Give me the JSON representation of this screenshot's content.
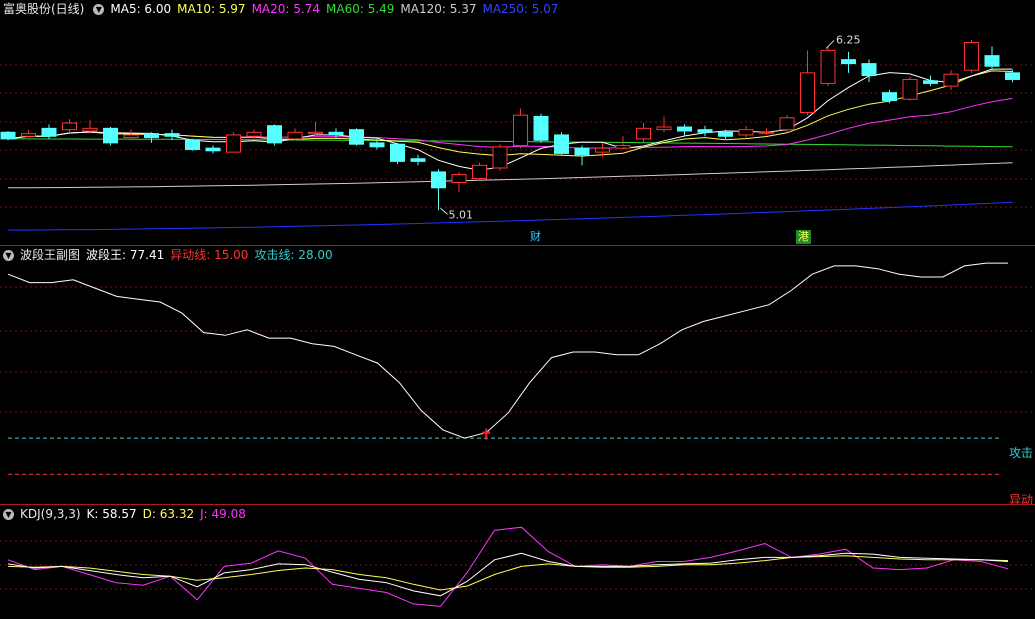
{
  "main": {
    "title": "富奥股份(日线)",
    "ma": [
      {
        "label": "MA5: 6.00",
        "color": "#ffffff"
      },
      {
        "label": "MA10: 5.97",
        "color": "#ffff55"
      },
      {
        "label": "MA20: 5.74",
        "color": "#ff33ff"
      },
      {
        "label": "MA60: 5.49",
        "color": "#33dd33"
      },
      {
        "label": "MA120: 5.37",
        "color": "#cccccc"
      },
      {
        "label": "MA250: 5.07",
        "color": "#3344ff"
      }
    ],
    "high_label": "6.25",
    "low_label": "5.01",
    "markers": {
      "cai": "财",
      "gang": "港"
    },
    "ymin": 4.8,
    "ymax": 6.45,
    "candles": [
      [
        5.6,
        5.55,
        5.61,
        5.54
      ],
      [
        5.57,
        5.59,
        5.62,
        5.56
      ],
      [
        5.63,
        5.57,
        5.66,
        5.55
      ],
      [
        5.62,
        5.67,
        5.7,
        5.6
      ],
      [
        5.61,
        5.63,
        5.69,
        5.59
      ],
      [
        5.63,
        5.52,
        5.64,
        5.5
      ],
      [
        5.56,
        5.58,
        5.62,
        5.55
      ],
      [
        5.59,
        5.56,
        5.6,
        5.52
      ],
      [
        5.59,
        5.57,
        5.62,
        5.54
      ],
      [
        5.54,
        5.47,
        5.55,
        5.46
      ],
      [
        5.48,
        5.46,
        5.5,
        5.44
      ],
      [
        5.45,
        5.58,
        5.6,
        5.45
      ],
      [
        5.57,
        5.6,
        5.62,
        5.55
      ],
      [
        5.65,
        5.52,
        5.66,
        5.5
      ],
      [
        5.55,
        5.6,
        5.63,
        5.54
      ],
      [
        5.59,
        5.6,
        5.68,
        5.57
      ],
      [
        5.6,
        5.58,
        5.63,
        5.56
      ],
      [
        5.62,
        5.51,
        5.63,
        5.5
      ],
      [
        5.52,
        5.49,
        5.55,
        5.47
      ],
      [
        5.51,
        5.38,
        5.52,
        5.36
      ],
      [
        5.4,
        5.38,
        5.43,
        5.35
      ],
      [
        5.3,
        5.18,
        5.32,
        5.01
      ],
      [
        5.22,
        5.28,
        5.3,
        5.15
      ],
      [
        5.25,
        5.35,
        5.37,
        5.23
      ],
      [
        5.33,
        5.49,
        5.51,
        5.31
      ],
      [
        5.5,
        5.73,
        5.78,
        5.48
      ],
      [
        5.72,
        5.54,
        5.74,
        5.52
      ],
      [
        5.58,
        5.44,
        5.6,
        5.43
      ],
      [
        5.48,
        5.43,
        5.5,
        5.35
      ],
      [
        5.45,
        5.48,
        5.52,
        5.41
      ],
      [
        5.48,
        5.5,
        5.57,
        5.47
      ],
      [
        5.55,
        5.63,
        5.67,
        5.52
      ],
      [
        5.62,
        5.64,
        5.72,
        5.6
      ],
      [
        5.64,
        5.61,
        5.66,
        5.57
      ],
      [
        5.62,
        5.6,
        5.65,
        5.57
      ],
      [
        5.6,
        5.57,
        5.62,
        5.55
      ],
      [
        5.58,
        5.62,
        5.65,
        5.56
      ],
      [
        5.6,
        5.6,
        5.63,
        5.58
      ],
      [
        5.62,
        5.71,
        5.73,
        5.6
      ],
      [
        5.75,
        6.05,
        6.22,
        5.73
      ],
      [
        5.97,
        6.22,
        6.25,
        5.95
      ],
      [
        6.15,
        6.12,
        6.21,
        6.05
      ],
      [
        6.12,
        6.03,
        6.15,
        5.98
      ],
      [
        5.9,
        5.84,
        5.92,
        5.82
      ],
      [
        5.85,
        6.0,
        6.02,
        5.84
      ],
      [
        5.99,
        5.97,
        6.03,
        5.95
      ],
      [
        5.95,
        6.04,
        6.07,
        5.92
      ],
      [
        6.07,
        6.28,
        6.3,
        6.05
      ],
      [
        6.18,
        6.1,
        6.25,
        6.08
      ],
      [
        6.05,
        6.0,
        6.07,
        5.98
      ]
    ]
  },
  "sub1": {
    "title": "波段王副图",
    "items": [
      {
        "label": "波段王: 77.41",
        "color": "#ffffff"
      },
      {
        "label": "异动线: 15.00",
        "color": "#ff3333"
      },
      {
        "label": "攻击线: 28.00",
        "color": "#33cccc"
      }
    ],
    "attack_label": "攻击",
    "anomaly_label": "异动",
    "ymin": 5,
    "ymax": 95,
    "attack": 28,
    "anomaly": 15,
    "values": [
      87,
      84,
      84,
      85,
      82,
      79,
      78,
      77,
      73,
      66,
      65,
      67,
      64,
      64,
      62,
      61,
      58,
      55,
      48,
      38,
      31,
      28,
      30,
      37,
      48,
      57,
      59,
      59,
      58,
      58,
      62,
      67,
      70,
      72,
      74,
      76,
      81,
      87,
      90,
      90,
      89,
      87,
      86,
      86,
      90,
      91,
      91
    ]
  },
  "sub2": {
    "title": "KDJ(9,3,3)",
    "items": [
      {
        "label": "K: 58.57",
        "color": "#ffffff"
      },
      {
        "label": "D: 63.32",
        "color": "#ffff55"
      },
      {
        "label": "J: 49.08",
        "color": "#ff33ff"
      }
    ],
    "ymin": -10,
    "ymax": 110,
    "K": [
      55,
      50,
      52,
      47,
      42,
      38,
      40,
      27,
      44,
      48,
      55,
      54,
      45,
      36,
      32,
      22,
      16,
      34,
      60,
      68,
      58,
      52,
      52,
      52,
      54,
      55,
      56,
      60,
      63,
      63,
      65,
      68,
      67,
      63,
      62,
      61,
      60,
      58
    ],
    "D": [
      52,
      51,
      52,
      50,
      46,
      42,
      40,
      35,
      38,
      42,
      47,
      50,
      48,
      42,
      38,
      30,
      23,
      28,
      42,
      52,
      55,
      52,
      51,
      51,
      52,
      54,
      54,
      56,
      59,
      63,
      64,
      65,
      63,
      61,
      60,
      60,
      60,
      59
    ],
    "J": [
      60,
      48,
      52,
      42,
      32,
      29,
      40,
      11,
      52,
      56,
      71,
      62,
      30,
      25,
      20,
      6,
      3,
      45,
      96,
      100,
      70,
      52,
      54,
      52,
      58,
      58,
      63,
      71,
      80,
      63,
      67,
      73,
      50,
      48,
      50,
      60,
      58,
      49
    ]
  }
}
